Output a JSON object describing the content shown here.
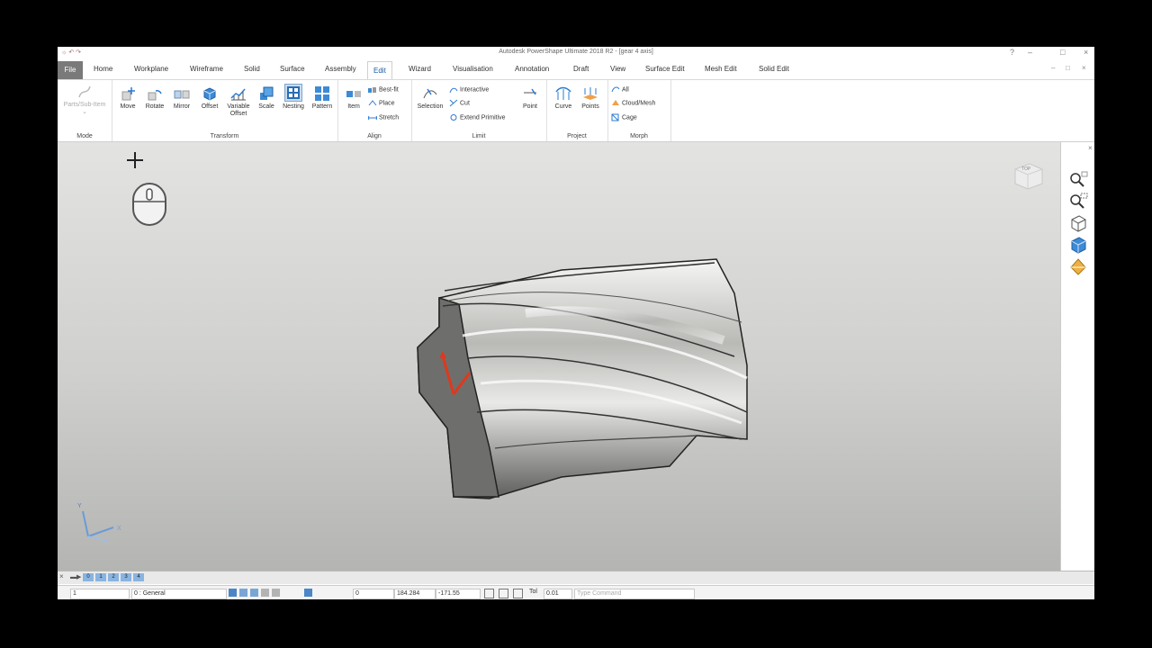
{
  "window": {
    "title": "Autodesk PowerShape Ultimate 2018 R2 - [gear 4 axis]",
    "quick_access": "☼ ↶ ↷"
  },
  "tabs": {
    "file": "File",
    "items": [
      "Home",
      "Workplane",
      "Wireframe",
      "Solid",
      "Surface",
      "Assembly",
      "Edit",
      "Wizard",
      "Visualisation",
      "Annotation",
      "Draft",
      "View",
      "Surface Edit",
      "Mesh Edit",
      "Solid Edit"
    ],
    "active": "Edit"
  },
  "ribbon": {
    "mode": {
      "button": "Parts/Sub-Item",
      "group": "Mode"
    },
    "transform": {
      "buttons": [
        "Move",
        "Rotate",
        "Mirror",
        "Offset",
        "Variable Offset",
        "Scale",
        "Nesting",
        "Pattern"
      ],
      "group": "Transform"
    },
    "align": {
      "item": "Item",
      "best_fit": "Best-fit",
      "place": "Place",
      "stretch": "Stretch",
      "group": "Align"
    },
    "limit": {
      "selection": "Selection",
      "interactive": "Interactive",
      "cut": "Cut",
      "extend_primitive": "Extend Primitive",
      "point": "Point",
      "group": "Limit"
    },
    "project": {
      "curve": "Curve",
      "points": "Points",
      "group": "Project"
    },
    "morph": {
      "all": "All",
      "cloud_mesh": "Cloud/Mesh",
      "cage": "Cage",
      "group": "Morph"
    }
  },
  "viewport": {
    "view_cube_label": "TOP",
    "axis": {
      "x": "X",
      "y": "Y"
    }
  },
  "command_row": {
    "layers": [
      "0",
      "1",
      "2",
      "3",
      "4"
    ]
  },
  "status": {
    "level": "1",
    "workplane": "0 : General",
    "field_value": "0",
    "x_coord": "184.284",
    "y_coord": "-171.55",
    "tol_label": "Tol",
    "tol_value": "0.01",
    "command_placeholder": "Type Command"
  },
  "colors": {
    "accent": "#1a5aa6",
    "file_tab": "#7a7a7a",
    "triad_red": "#e0381c"
  }
}
